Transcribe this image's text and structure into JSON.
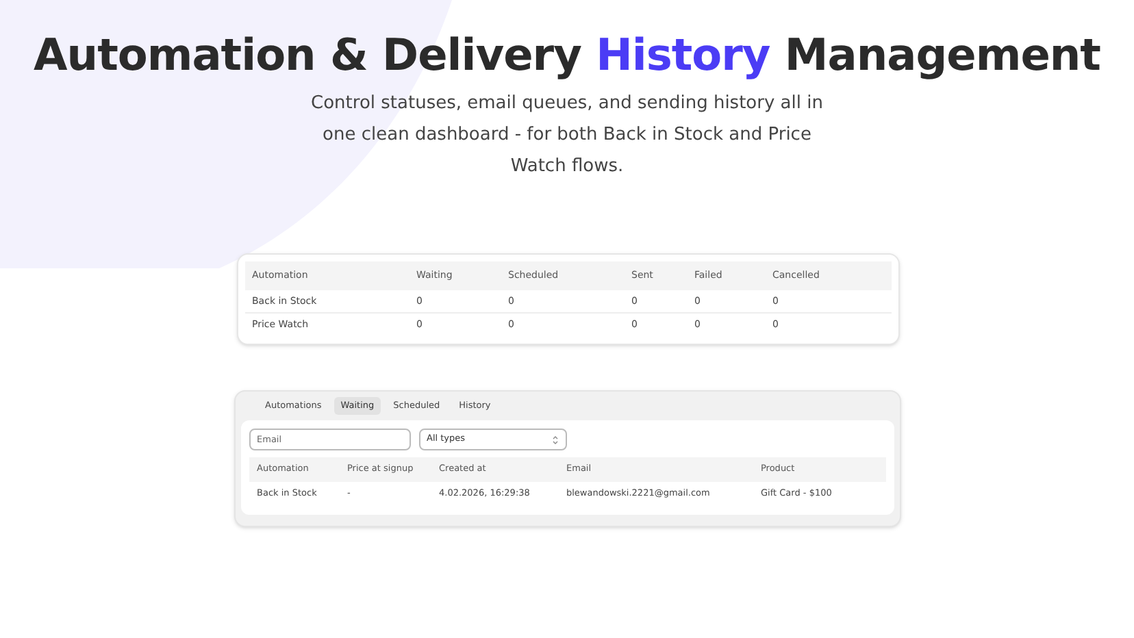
{
  "header": {
    "title_before": "Automation & Delivery ",
    "title_highlight": "History",
    "title_after": " Management",
    "subtitle": "Control statuses, email queues, and sending history all in one clean dashboard - for both Back in Stock and Price Watch flows."
  },
  "summary_table": {
    "columns": [
      "Automation",
      "Waiting",
      "Scheduled",
      "Sent",
      "Failed",
      "Cancelled"
    ],
    "rows": [
      [
        "Back in Stock",
        "0",
        "0",
        "0",
        "0",
        "0"
      ],
      [
        "Price Watch",
        "0",
        "0",
        "0",
        "0",
        "0"
      ]
    ]
  },
  "queue_panel": {
    "tabs": [
      {
        "label": "Automations",
        "selected": false
      },
      {
        "label": "Waiting",
        "selected": true
      },
      {
        "label": "Scheduled",
        "selected": false
      },
      {
        "label": "History",
        "selected": false
      }
    ],
    "email_filter": {
      "placeholder": "Email"
    },
    "type_filter": {
      "value": "All types"
    },
    "table": {
      "columns": [
        "Automation",
        "Price at signup",
        "Created at",
        "Email",
        "Product"
      ],
      "rows": [
        [
          "Back in Stock",
          "-",
          "4.02.2026, 16:29:38",
          "blewandowski.2221@gmail.com",
          "Gift Card - $100"
        ]
      ]
    }
  }
}
